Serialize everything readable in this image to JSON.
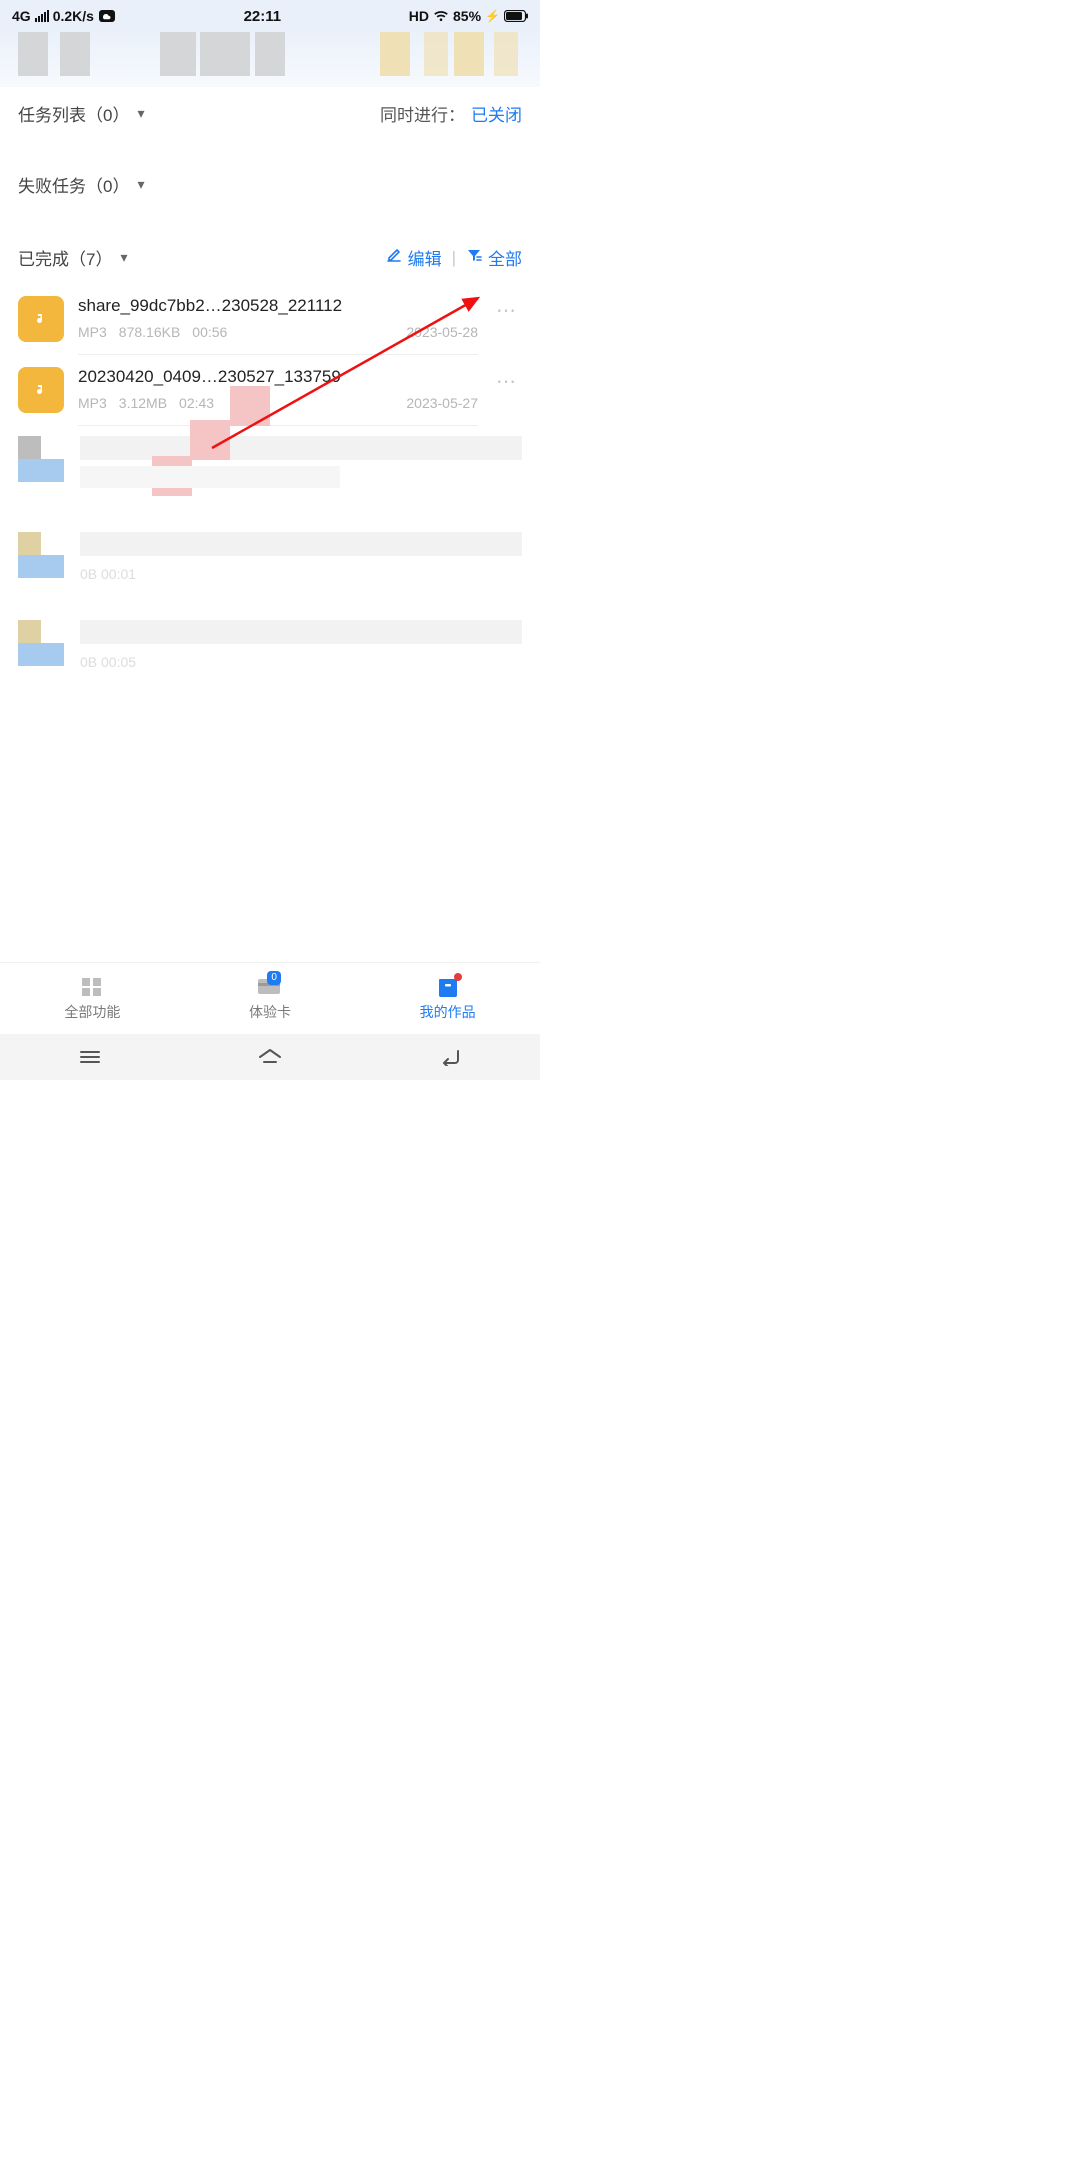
{
  "status": {
    "network": "4G",
    "speed": "0.2K/s",
    "time": "22:11",
    "hd": "HD",
    "battery": "85%"
  },
  "sections": {
    "tasks": {
      "label": "任务列表（0）"
    },
    "failed": {
      "label": "失败任务（0）"
    },
    "done": {
      "label": "已完成（7）"
    }
  },
  "concurrent": {
    "label": "同时进行：",
    "value": "已关闭"
  },
  "actions": {
    "edit": "编辑",
    "all": "全部"
  },
  "files": [
    {
      "name": "share_99dc7bb2…230528_221112",
      "type": "MP3",
      "size": "878.16KB",
      "dur": "00:56",
      "date": "2023-05-28"
    },
    {
      "name": "20230420_0409…230527_133759",
      "type": "MP3",
      "size": "3.12MB",
      "dur": "02:43",
      "date": "2023-05-27"
    }
  ],
  "obscured": [
    {
      "sub": ""
    },
    {
      "sub": "0B  00:01"
    },
    {
      "sub": "0B  00:05"
    }
  ],
  "tabs": {
    "all": "全部功能",
    "trial": "体验卡",
    "mine": "我的作品",
    "trial_badge": "0"
  }
}
